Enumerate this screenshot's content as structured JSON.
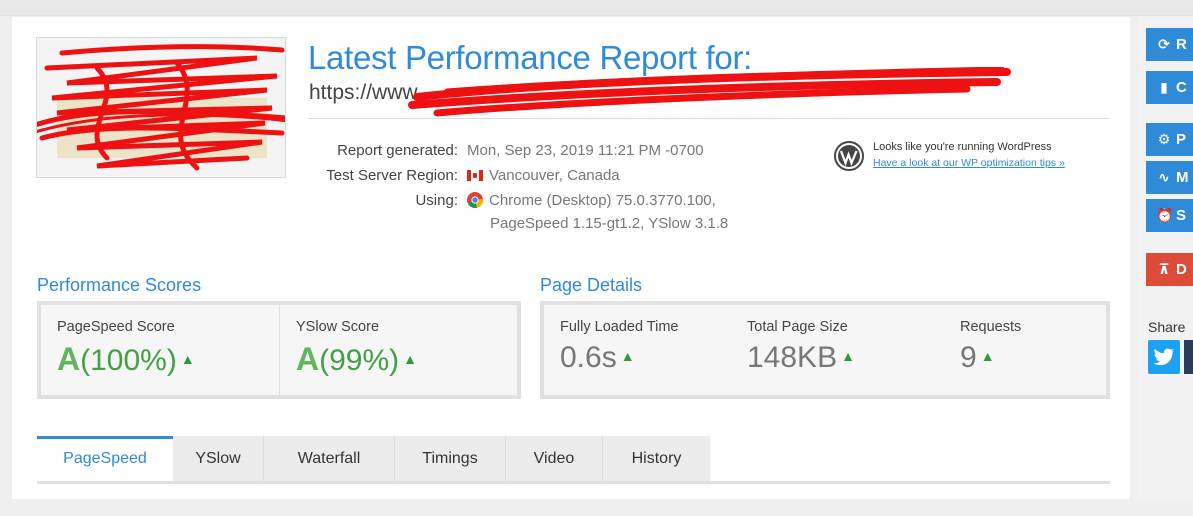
{
  "report": {
    "title": "Latest Performance Report for:",
    "url_prefix": "https://www"
  },
  "meta": {
    "generated_label": "Report generated:",
    "generated_value": "Mon, Sep 23, 2019 11:21 PM -0700",
    "region_label": "Test Server Region:",
    "region_value": "Vancouver, Canada",
    "using_label": "Using:",
    "using_line1": "Chrome (Desktop) 75.0.3770.100,",
    "using_line2": "PageSpeed 1.15-gt1.2, YSlow 3.1.8"
  },
  "wordpress": {
    "text": "Looks like you're running WordPress",
    "link": "Have a look at our WP optimization tips »"
  },
  "performance": {
    "title": "Performance Scores",
    "pagespeed_label": "PageSpeed Score",
    "pagespeed_grade": "A",
    "pagespeed_value": "(100%)",
    "yslow_label": "YSlow Score",
    "yslow_grade": "A",
    "yslow_value": "(99%)"
  },
  "details": {
    "title": "Page Details",
    "loaded_label": "Fully Loaded Time",
    "loaded_value": "0.6s",
    "size_label": "Total Page Size",
    "size_value": "148KB",
    "requests_label": "Requests",
    "requests_value": "9"
  },
  "tabs": [
    "PageSpeed",
    "YSlow",
    "Waterfall",
    "Timings",
    "Video",
    "History"
  ],
  "sidebar": {
    "buttons": [
      "R",
      "C",
      "P",
      "M",
      "S",
      "D"
    ],
    "share_label": "Share"
  },
  "colors": {
    "accent": "#2f8bd8",
    "grade_green": "#43a047",
    "danger": "#dd4b39"
  }
}
